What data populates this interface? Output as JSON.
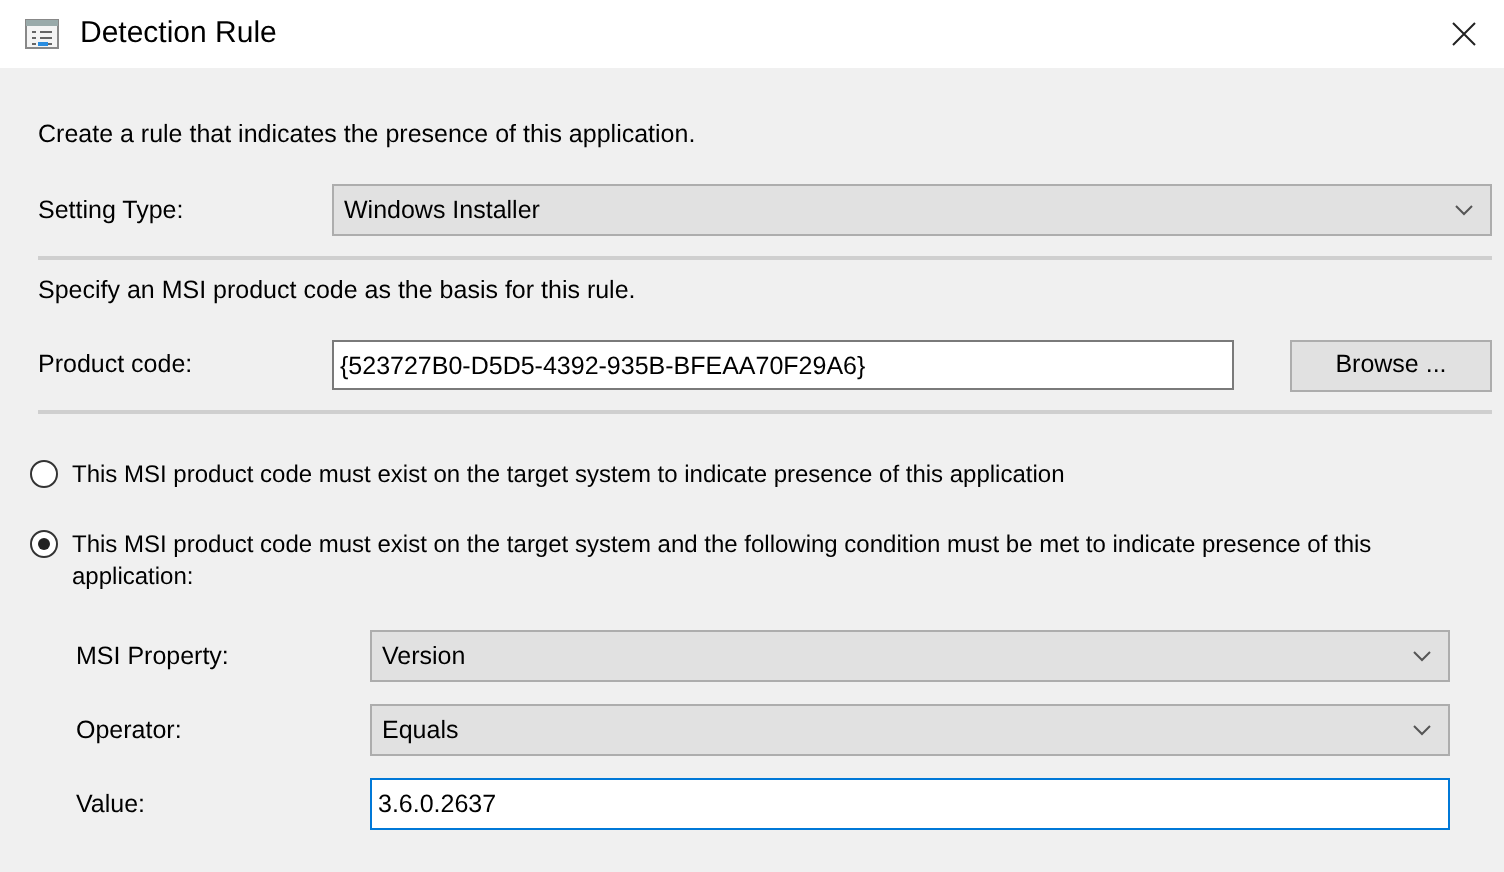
{
  "window": {
    "title": "Detection Rule"
  },
  "intro": "Create a rule that indicates the presence of this application.",
  "setting_type": {
    "label": "Setting Type:",
    "value": "Windows Installer"
  },
  "instruction": "Specify an MSI product code as the basis for this rule.",
  "product_code": {
    "label": "Product code:",
    "value": "{523727B0-D5D5-4392-935B-BFEAA70F29A6}"
  },
  "browse_button": "Browse ...",
  "options": [
    {
      "label": "This MSI product code must exist on the target system to indicate presence of this application",
      "selected": false
    },
    {
      "label": "This MSI product code must exist on the target system and the following condition must be met to indicate presence of this application:",
      "selected": true
    }
  ],
  "condition_fields": [
    {
      "kind": "dropdown",
      "label": "MSI Property:",
      "value": "Version",
      "focused": false
    },
    {
      "kind": "dropdown",
      "label": "Operator:",
      "value": "Equals",
      "focused": false
    },
    {
      "kind": "text",
      "label": "Value:",
      "value": "3.6.0.2637",
      "focused": true
    }
  ]
}
